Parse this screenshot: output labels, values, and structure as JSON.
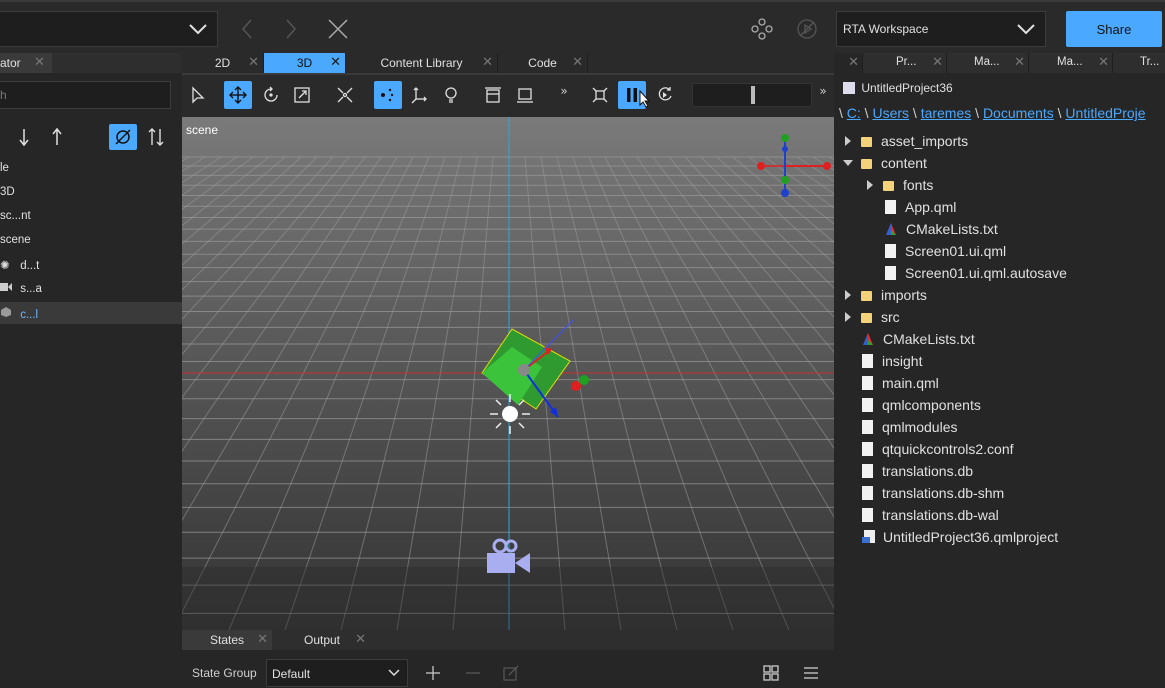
{
  "workspace": {
    "name": "RTA Workspace"
  },
  "share_label": "Share",
  "navigator": {
    "tab_label": "ator",
    "search_placeholder": "h",
    "items": [
      {
        "label": "le"
      },
      {
        "label": "3D"
      },
      {
        "label": "sc...nt"
      },
      {
        "label": "scene"
      },
      {
        "label": "d...t"
      },
      {
        "label": "s...a"
      },
      {
        "label": "c...l"
      }
    ]
  },
  "view_tabs": [
    {
      "label": "2D"
    },
    {
      "label": "3D"
    },
    {
      "label": "Content Library"
    },
    {
      "label": "Code"
    }
  ],
  "viewport": {
    "scene_label": "scene"
  },
  "states": {
    "tabs": [
      {
        "label": "States"
      },
      {
        "label": "Output"
      }
    ],
    "group_label": "State Group",
    "group_value": "Default"
  },
  "right_tabs": [
    {
      "label": "Pr..."
    },
    {
      "label": "Ma..."
    },
    {
      "label": "Ma..."
    },
    {
      "label": "Tr..."
    }
  ],
  "project": {
    "title": "UntitledProject36",
    "breadcrumb": [
      "C:",
      "Users",
      "taremes",
      "Documents",
      "UntitledProje"
    ],
    "files": [
      {
        "label": "asset_imports"
      },
      {
        "label": "content"
      },
      {
        "label": "fonts"
      },
      {
        "label": "App.qml"
      },
      {
        "label": "CMakeLists.txt"
      },
      {
        "label": "Screen01.ui.qml"
      },
      {
        "label": "Screen01.ui.qml.autosave"
      },
      {
        "label": "imports"
      },
      {
        "label": "src"
      },
      {
        "label": "CMakeLists.txt"
      },
      {
        "label": "insight"
      },
      {
        "label": "main.qml"
      },
      {
        "label": "qmlcomponents"
      },
      {
        "label": "qmlmodules"
      },
      {
        "label": "qtquickcontrols2.conf"
      },
      {
        "label": "translations.db"
      },
      {
        "label": "translations.db-shm"
      },
      {
        "label": "translations.db-wal"
      },
      {
        "label": "UntitledProject36.qmlproject"
      }
    ]
  },
  "colors": {
    "accent": "#4aa8ff",
    "folder": "#f3d27a"
  }
}
